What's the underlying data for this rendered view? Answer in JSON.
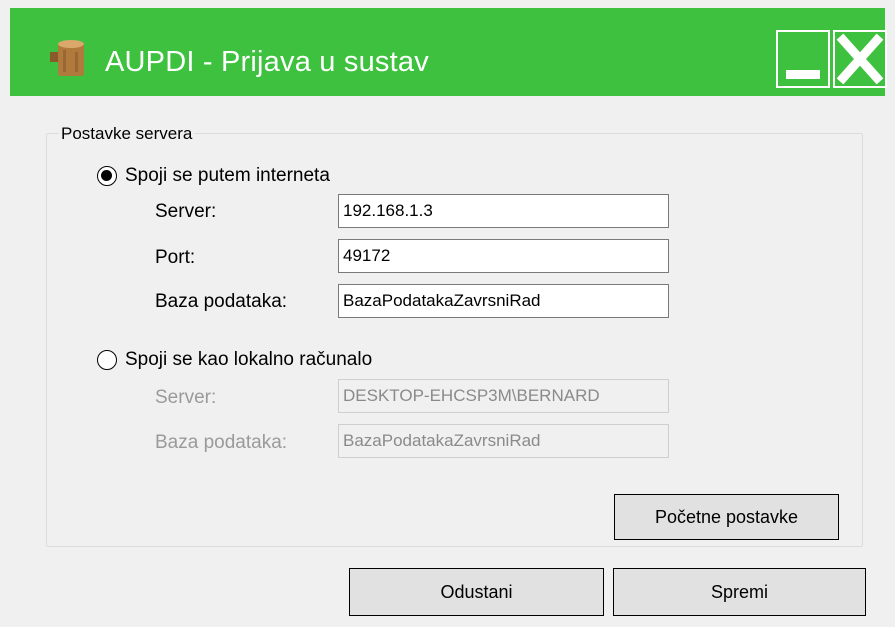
{
  "window": {
    "title": "AUPDI - Prijava u sustav",
    "app_icon": "wood-stump-icon",
    "minimize_icon": "minimize-icon",
    "close_icon": "close-icon",
    "accent_color": "#3ec13e"
  },
  "server_settings": {
    "group_label": "Postavke servera",
    "internet": {
      "radio_label": "Spoji se putem interneta",
      "selected": true,
      "server_label": "Server:",
      "server_value": "192.168.1.3",
      "port_label": "Port:",
      "port_value": "49172",
      "database_label": "Baza podataka:",
      "database_value": "BazaPodatakaZavrsniRad"
    },
    "local": {
      "radio_label": "Spoji se kao lokalno računalo",
      "selected": false,
      "server_label": "Server:",
      "server_value": "DESKTOP-EHCSP3M\\BERNARD",
      "database_label": "Baza podataka:",
      "database_value": "BazaPodatakaZavrsniRad"
    },
    "reset_button": "Početne postavke"
  },
  "footer": {
    "cancel_button": "Odustani",
    "save_button": "Spremi"
  }
}
